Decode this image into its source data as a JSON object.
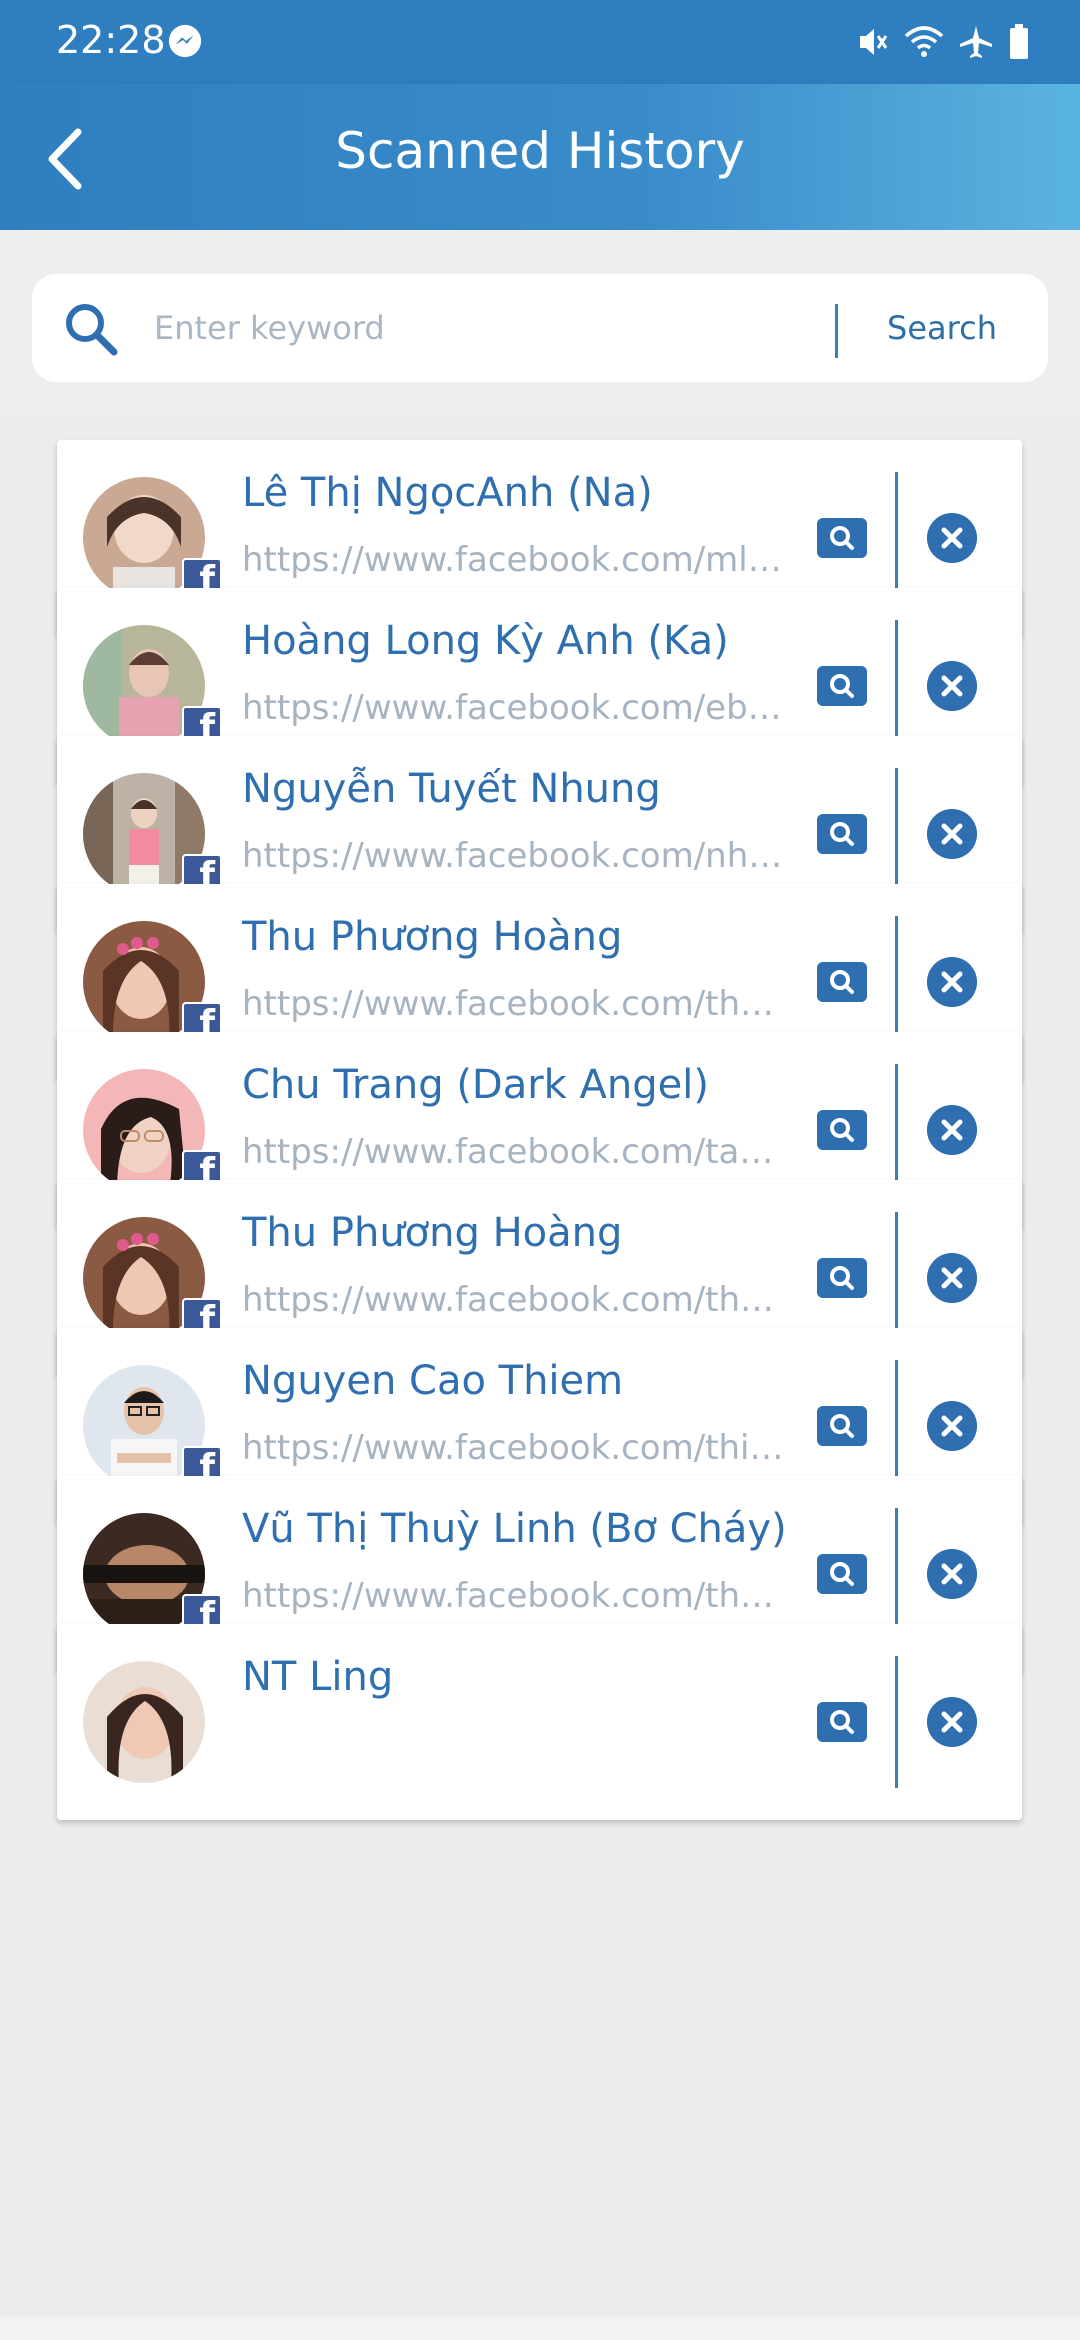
{
  "status_bar": {
    "time": "22:28",
    "icons": [
      "messenger-icon",
      "mute-icon",
      "wifi-icon",
      "airplane-icon",
      "battery-icon"
    ]
  },
  "header": {
    "title": "Scanned History",
    "back_icon": "chevron-left-icon"
  },
  "search": {
    "placeholder": "Enter keyword",
    "value": "",
    "button_label": "Search"
  },
  "colors": {
    "primary": "#2f6fb0",
    "header_start": "#2f7fc0",
    "header_end": "#5ab4e0",
    "url_text": "#a6b3c0",
    "facebook": "#3b5998"
  },
  "history": [
    {
      "name": "Lê Thị NgọcAnh (Na)",
      "url": "https://www.facebook.com/mlb..."
    },
    {
      "name": "Hoàng Long Kỳ Anh (Ka)",
      "url": "https://www.facebook.com/ebe..."
    },
    {
      "name": "Nguyễn Tuyết Nhung",
      "url": "https://www.facebook.com/nhu..."
    },
    {
      "name": "Thu Phương Hoàng",
      "url": "https://www.facebook.com/thu..."
    },
    {
      "name": "Chu Trang (Dark Angel)",
      "url": "https://www.facebook.com/tak..."
    },
    {
      "name": "Thu Phương Hoàng",
      "url": "https://www.facebook.com/thu..."
    },
    {
      "name": "Nguyen Cao Thiem",
      "url": "https://www.facebook.com/thie..."
    },
    {
      "name": "Vũ Thị Thuỳ Linh (Bơ Cháy)",
      "url": "https://www.facebook.com/thu..."
    },
    {
      "name": "NT Ling",
      "url": ""
    }
  ]
}
